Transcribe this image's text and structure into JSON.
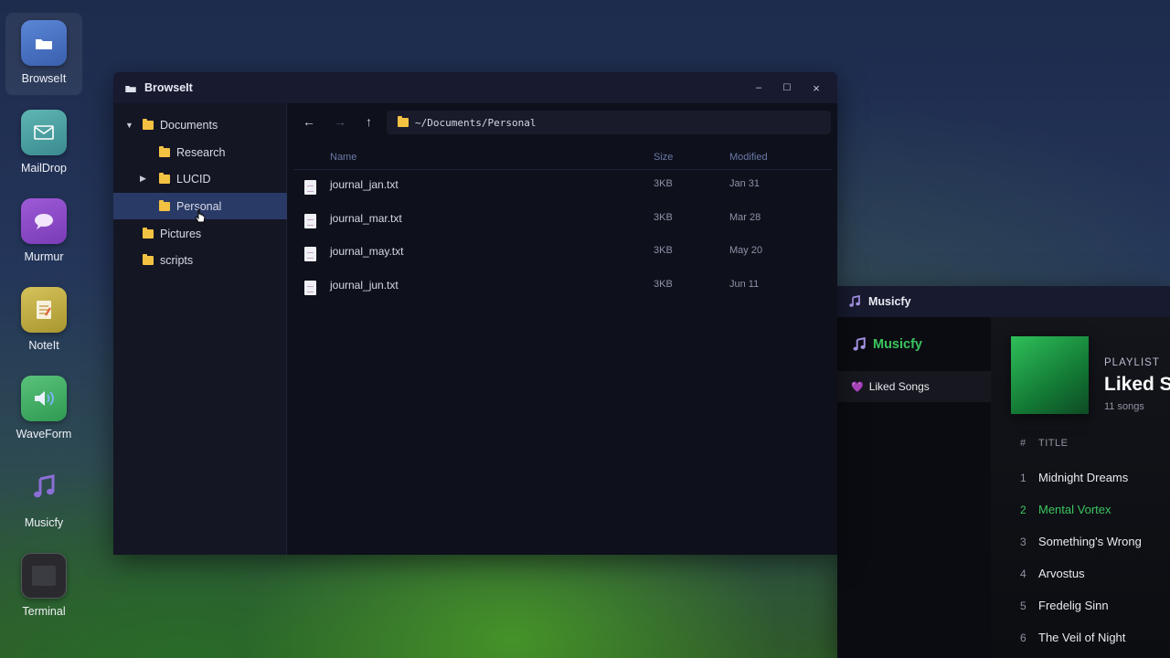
{
  "dock": {
    "items": [
      {
        "label": "BrowseIt"
      },
      {
        "label": "MailDrop"
      },
      {
        "label": "Murmur"
      },
      {
        "label": "NoteIt"
      },
      {
        "label": "WaveForm"
      },
      {
        "label": "Musicfy"
      },
      {
        "label": "Terminal"
      }
    ]
  },
  "browser": {
    "title": "BrowseIt",
    "controls": {
      "minimize": "–",
      "maximize": "☐",
      "close": "×"
    },
    "tree": [
      {
        "label": "Documents",
        "expanded": true
      },
      {
        "label": "Research"
      },
      {
        "label": "LUCID",
        "collapsed": true
      },
      {
        "label": "Personal",
        "selected": true
      },
      {
        "label": "Pictures"
      },
      {
        "label": "scripts"
      }
    ],
    "toolbar": {
      "back": "←",
      "forward": "→",
      "up": "↑",
      "path": "~/Documents/Personal"
    },
    "columns": {
      "name": "Name",
      "size": "Size",
      "modified": "Modified"
    },
    "files": [
      {
        "name": "journal_jan.txt",
        "size": "3KB",
        "modified": "Jan 31"
      },
      {
        "name": "journal_mar.txt",
        "size": "3KB",
        "modified": "Mar 28"
      },
      {
        "name": "journal_may.txt",
        "size": "3KB",
        "modified": "May 20"
      },
      {
        "name": "journal_jun.txt",
        "size": "3KB",
        "modified": "Jun 11"
      }
    ]
  },
  "music": {
    "title": "Musicfy",
    "brand": "Musicfy",
    "nav": {
      "liked": "Liked Songs"
    },
    "playlist": {
      "kind": "PLAYLIST",
      "name": "Liked So",
      "count": "11 songs"
    },
    "table_header": {
      "num": "#",
      "title": "TITLE"
    },
    "tracks": [
      {
        "num": "1",
        "title": "Midnight Dreams"
      },
      {
        "num": "2",
        "title": "Mental Vortex",
        "playing": true
      },
      {
        "num": "3",
        "title": "Something's Wrong"
      },
      {
        "num": "4",
        "title": "Arvostus"
      },
      {
        "num": "5",
        "title": "Fredelig Sinn"
      },
      {
        "num": "6",
        "title": "The Veil of Night"
      }
    ],
    "accent": "#3bc45e"
  }
}
